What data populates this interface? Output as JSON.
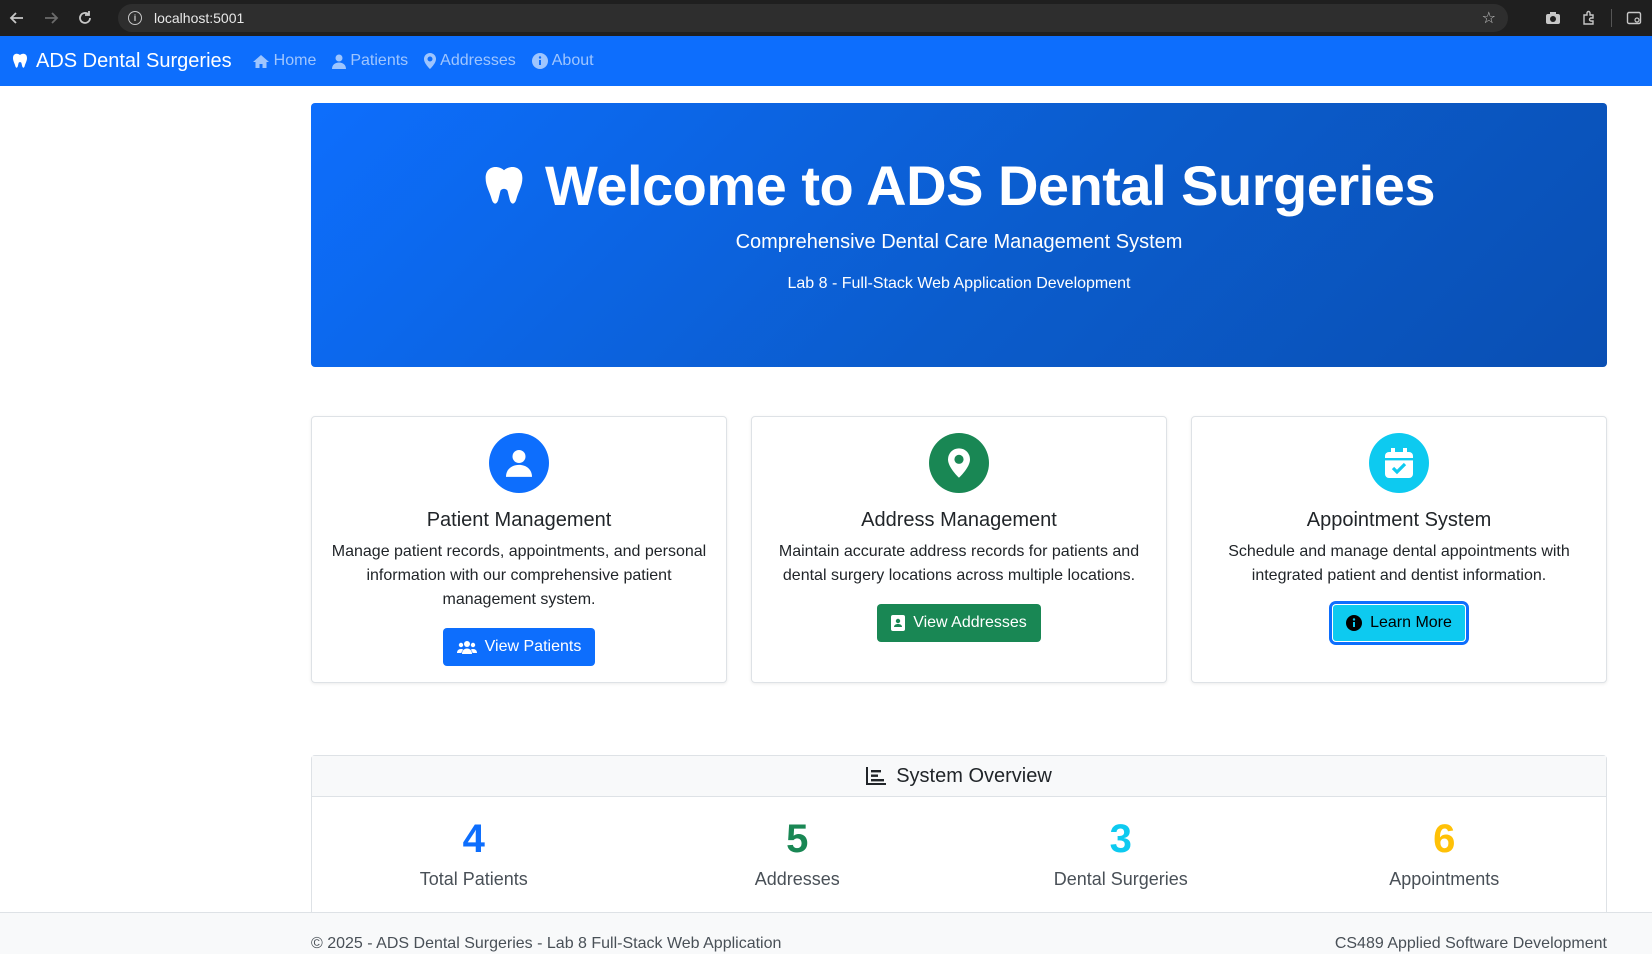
{
  "browser": {
    "url": "localhost:5001"
  },
  "navbar": {
    "brand": "ADS Dental Surgeries",
    "links": [
      {
        "label": "Home"
      },
      {
        "label": "Patients"
      },
      {
        "label": "Addresses"
      },
      {
        "label": "About"
      }
    ]
  },
  "hero": {
    "title": "Welcome to ADS Dental Surgeries",
    "subtitle": "Comprehensive Dental Care Management System",
    "lab": "Lab 8 - Full-Stack Web Application Development"
  },
  "cards": [
    {
      "title": "Patient Management",
      "text": "Manage patient records, appointments, and personal information with our comprehensive patient management system.",
      "button": "View Patients",
      "color": "#0d6efd"
    },
    {
      "title": "Address Management",
      "text": "Maintain accurate address records for patients and dental surgery locations across multiple locations.",
      "button": "View Addresses",
      "color": "#198754"
    },
    {
      "title": "Appointment System",
      "text": "Schedule and manage dental appointments with integrated patient and dentist information.",
      "button": "Learn More",
      "color": "#0dcaf0"
    }
  ],
  "overview": {
    "title": "System Overview",
    "stats": [
      {
        "value": "4",
        "label": "Total Patients",
        "color": "#0d6efd"
      },
      {
        "value": "5",
        "label": "Addresses",
        "color": "#198754"
      },
      {
        "value": "3",
        "label": "Dental Surgeries",
        "color": "#0dcaf0"
      },
      {
        "value": "6",
        "label": "Appointments",
        "color": "#ffc107"
      }
    ]
  },
  "footer": {
    "left": "© 2025 - ADS Dental Surgeries - Lab 8 Full-Stack Web Application",
    "right": "CS489 Applied Software Development"
  }
}
